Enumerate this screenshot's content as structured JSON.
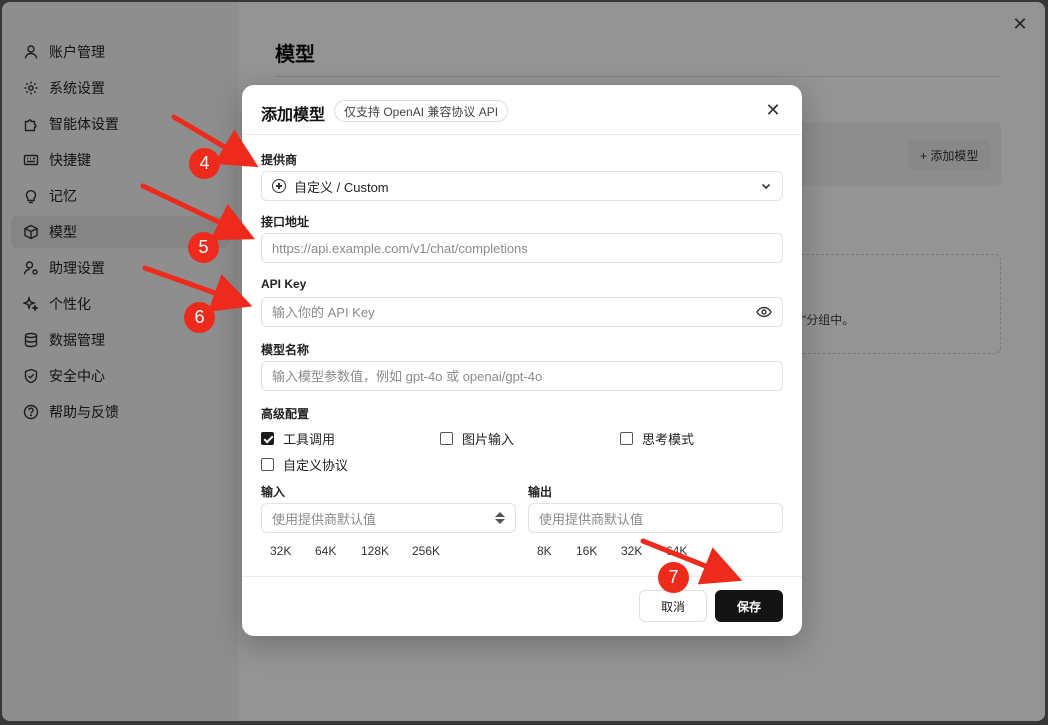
{
  "sidebar": {
    "items": [
      {
        "label": "账户管理",
        "icon": "user-icon"
      },
      {
        "label": "系统设置",
        "icon": "gear-icon"
      },
      {
        "label": "智能体设置",
        "icon": "puzzle-icon"
      },
      {
        "label": "快捷键",
        "icon": "keyboard-icon"
      },
      {
        "label": "记忆",
        "icon": "lightbulb-icon"
      },
      {
        "label": "模型",
        "icon": "cube-icon",
        "active": true
      },
      {
        "label": "助理设置",
        "icon": "user-gear-icon"
      },
      {
        "label": "个性化",
        "icon": "sparkle-icon"
      },
      {
        "label": "数据管理",
        "icon": "database-icon"
      },
      {
        "label": "安全中心",
        "icon": "shield-icon"
      },
      {
        "label": "帮助与反馈",
        "icon": "help-icon"
      }
    ]
  },
  "background_page": {
    "title": "模型",
    "add_model_label": "+ 添加模型",
    "empty_hint_partial": "型\"分组中。"
  },
  "modal": {
    "title": "添加模型",
    "tag": "仅支持 OpenAI 兼容协议 API",
    "provider": {
      "label": "提供商",
      "value": "自定义 / Custom"
    },
    "endpoint": {
      "label": "接口地址",
      "placeholder": "https://api.example.com/v1/chat/completions"
    },
    "api_key": {
      "label": "API Key",
      "placeholder": "输入你的 API Key"
    },
    "model_name": {
      "label": "模型名称",
      "placeholder": "输入模型参数值，例如 gpt-4o 或 openai/gpt-4o"
    },
    "advanced": {
      "label": "高级配置",
      "options": [
        {
          "label": "工具调用",
          "checked": true
        },
        {
          "label": "图片输入",
          "checked": false
        },
        {
          "label": "思考模式",
          "checked": false
        },
        {
          "label": "自定义协议",
          "checked": false
        }
      ]
    },
    "input": {
      "label": "输入",
      "placeholder": "使用提供商默认值",
      "chips": [
        "32K",
        "64K",
        "128K",
        "256K"
      ]
    },
    "output": {
      "label": "输出",
      "placeholder": "使用提供商默认值",
      "chips": [
        "8K",
        "16K",
        "32K",
        "64K"
      ]
    },
    "cancel_label": "取消",
    "save_label": "保存"
  },
  "annotations": {
    "badges": [
      "4",
      "5",
      "6",
      "7"
    ],
    "arrow_color": "#ee2a1c"
  }
}
